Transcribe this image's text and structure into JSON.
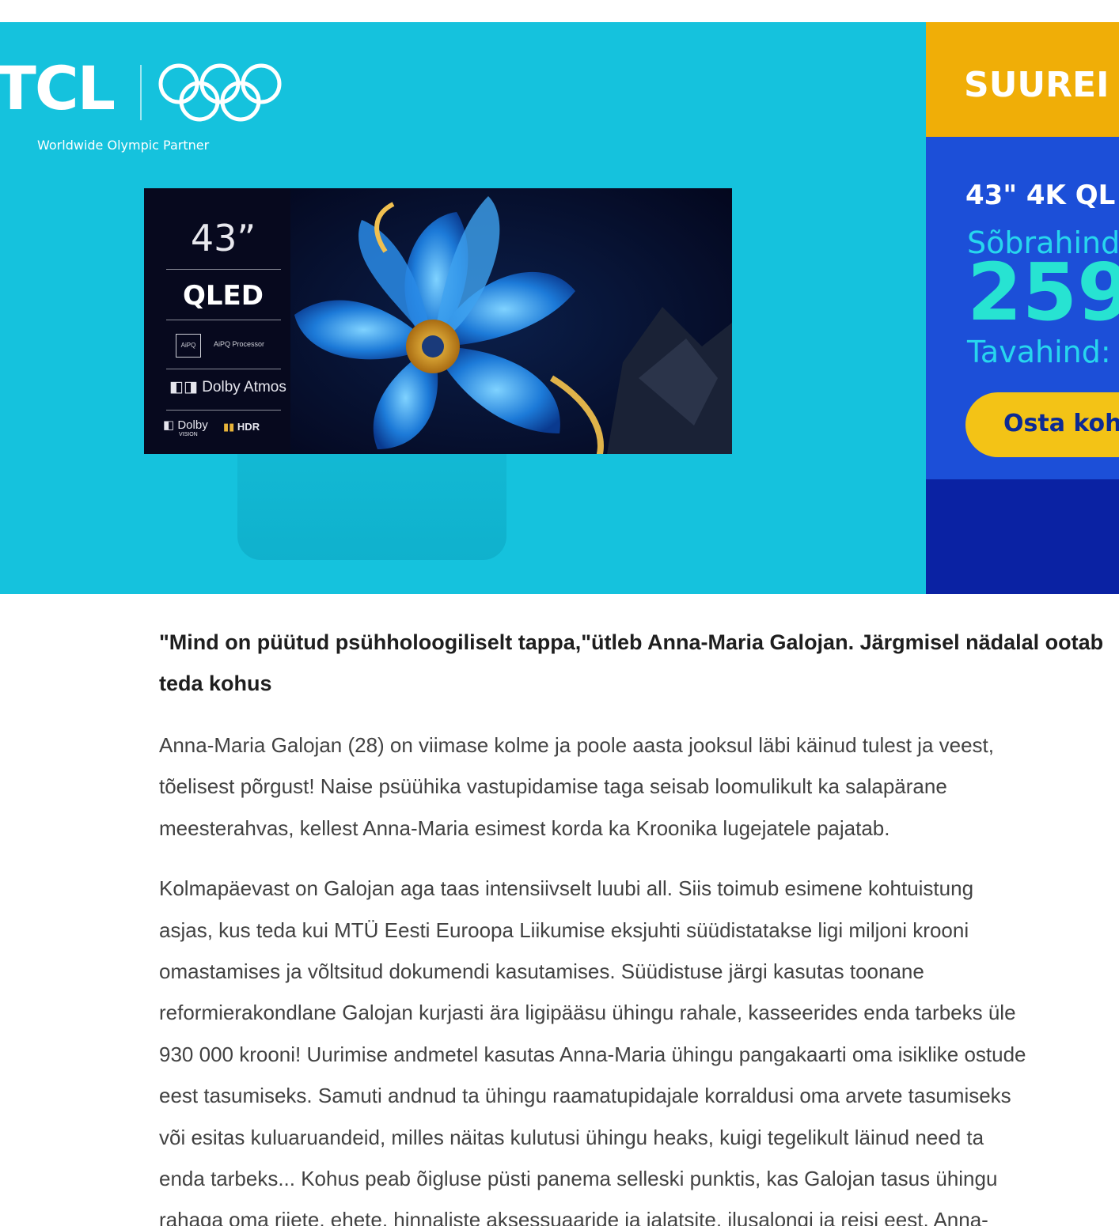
{
  "ad": {
    "brand": "TCL",
    "partner_text": "Worldwide Olympic Partner",
    "tv": {
      "size": "43”",
      "panel_type": "QLED",
      "chip_label": "AiPQ",
      "processor": "AiPQ Processor",
      "audio": "Dolby Atmos",
      "vision": "Dolby",
      "vision_sub": "VISION",
      "hdr": "HDR"
    },
    "offer": {
      "header": "SUUREI",
      "model": "43\" 4K QL",
      "friend_price_label": "Sõbrahind",
      "friend_price": "259",
      "regular_price_label": "Tavahind:",
      "button_label": "Osta koh"
    },
    "colors": {
      "background": "#15c2dd",
      "offer_yellow": "#f0ae07",
      "offer_blue": "#1c4fd8",
      "offer_dark_blue": "#0a22a3",
      "price_teal": "#27e3d2",
      "button_yellow": "#f3c316"
    }
  },
  "article": {
    "headline": "\"Mind on püütud psühholoogiliselt tappa,\"ütleb Anna-Maria Galojan. Järgmisel nädalal ootab teda kohus",
    "paragraphs": [
      {
        "lines": [
          "Anna-Maria Galojan (28) on viimase kolme ja poole aasta jooksul läbi käinud tulest ja veest,",
          "tõelisest põrgust! Naise psüühika vastupidamise taga seisab loomulikult ka salapärane",
          "meesterahvas, kellest Anna-Maria esimest korda ka Kroonika lugejatele pajatab."
        ]
      },
      {
        "lines": [
          "Kolmapäevast on Galojan aga taas intensiivselt luubi all. Siis toimub esimene kohtuistung",
          "asjas, kus teda kui MTÜ Eesti Euroopa Liikumise eksjuhti süüdistatakse ligi miljoni krooni",
          "omastamises ja võltsitud dokumendi kasutamises. Süüdistuse järgi kasutas toonane",
          "reformierakondlane Galojan kurjasti ära ligipääsu ühingu rahale, kasseerides enda tarbeks üle",
          "930 000 krooni! Uurimise andmetel kasutas Anna-Maria ühingu pangakaarti oma isiklike ostude",
          "eest tasumiseks. Samuti andnud ta ühingu raamatupidajale korraldusi oma arvete tasumiseks",
          "või esitas kuluaruandeid, milles näitas kulutusi ühingu heaks, kuigi tegelikult läinud need ta",
          "enda tarbeks... Kohus peab õigluse püsti panema selleski punktis, kas Galojan tasus ühingu",
          "rahaga oma riiete, ehete, hinnaliste aksessuaaride ja jalatsite, ilusalongi ja reisi eest. Anna-"
        ]
      }
    ]
  }
}
